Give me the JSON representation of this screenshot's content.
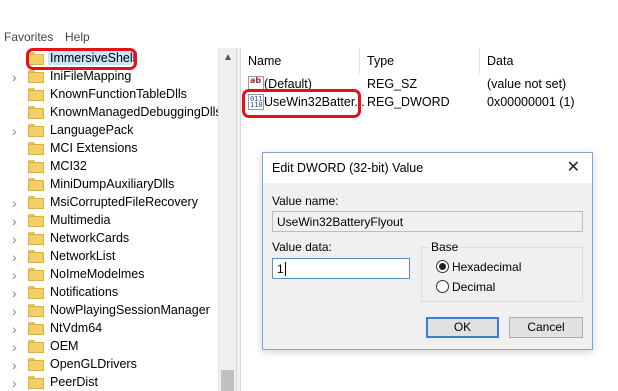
{
  "menubar": {
    "favorites": "Favorites",
    "help": "Help"
  },
  "tree": {
    "items": [
      {
        "label": "ImmersiveShell",
        "expandable": false,
        "selected": true
      },
      {
        "label": "IniFileMapping",
        "expandable": true
      },
      {
        "label": "KnownFunctionTableDlls",
        "expandable": false
      },
      {
        "label": "KnownManagedDebuggingDlls",
        "expandable": false
      },
      {
        "label": "LanguagePack",
        "expandable": true
      },
      {
        "label": "MCI Extensions",
        "expandable": false
      },
      {
        "label": "MCI32",
        "expandable": false
      },
      {
        "label": "MiniDumpAuxiliaryDlls",
        "expandable": false
      },
      {
        "label": "MsiCorruptedFileRecovery",
        "expandable": true
      },
      {
        "label": "Multimedia",
        "expandable": true
      },
      {
        "label": "NetworkCards",
        "expandable": true
      },
      {
        "label": "NetworkList",
        "expandable": true
      },
      {
        "label": "NoImeModelmes",
        "expandable": true
      },
      {
        "label": "Notifications",
        "expandable": true
      },
      {
        "label": "NowPlayingSessionManager",
        "expandable": true
      },
      {
        "label": "NtVdm64",
        "expandable": true
      },
      {
        "label": "OEM",
        "expandable": true
      },
      {
        "label": "OpenGLDrivers",
        "expandable": true
      },
      {
        "label": "PeerDist",
        "expandable": true
      }
    ]
  },
  "list": {
    "headers": {
      "name": "Name",
      "type": "Type",
      "data": "Data"
    },
    "rows": [
      {
        "icon": "string-value-icon",
        "name": "(Default)",
        "type": "REG_SZ",
        "data": "(value not set)"
      },
      {
        "icon": "dword-value-icon",
        "name": "UseWin32Batter...",
        "type": "REG_DWORD",
        "data": "0x00000001 (1)"
      }
    ]
  },
  "dialog": {
    "title": "Edit DWORD (32-bit) Value",
    "value_name_label": "Value name:",
    "value_name": "UseWin32BatteryFlyout",
    "value_data_label": "Value data:",
    "value_data": "1",
    "base_label": "Base",
    "hex_label": "Hexadecimal",
    "dec_label": "Decimal",
    "base_selected": "Hexadecimal",
    "ok_label": "OK",
    "cancel_label": "Cancel"
  },
  "icons": {
    "close": "close-icon",
    "expand": "chevron-right-icon",
    "folder": "folder-icon",
    "scroll_up": "scroll-up-arrow-icon"
  },
  "colors": {
    "highlight": "#e3111b",
    "selection": "#cce4f7",
    "default_button_border": "#3c7fd2"
  },
  "icon_text": {
    "string_value": "ab",
    "dword_value": "011 110"
  }
}
